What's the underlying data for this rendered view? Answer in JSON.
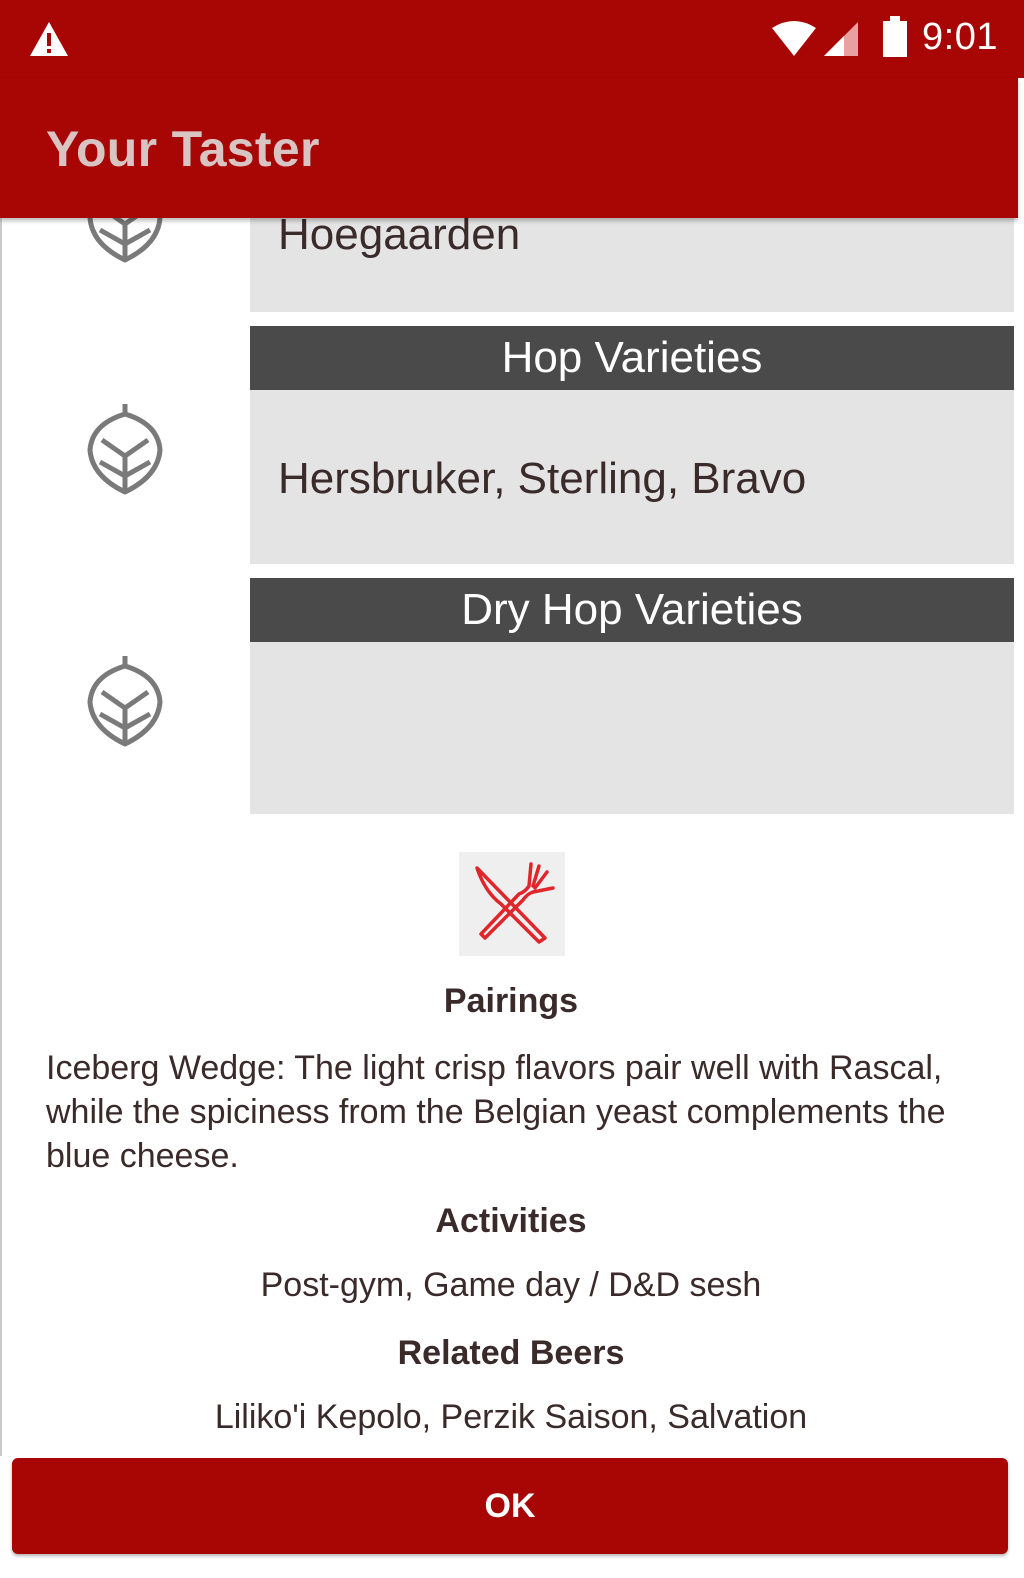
{
  "status_bar": {
    "time": "9:01",
    "icons": [
      "warning-icon",
      "wifi-icon",
      "signal-icon",
      "battery-icon"
    ]
  },
  "app_bar": {
    "title": "Your Taster"
  },
  "content": {
    "partial_card": {
      "value": "Hoegaarden"
    },
    "hop_card": {
      "header": "Hop Varieties",
      "value": "Hersbruker, Sterling, Bravo",
      "icon": "hop-icon"
    },
    "dry_hop_card": {
      "header": "Dry Hop Varieties",
      "value": "",
      "icon": "hop-icon"
    },
    "pairings": {
      "icon": "cutlery-icon",
      "title": "Pairings",
      "text": "Iceberg Wedge: The light crisp flavors pair well with Rascal, while the spiciness from the Belgian yeast complements the blue cheese."
    },
    "activities": {
      "title": "Activities",
      "text": "Post-gym, Game day / D&D sesh"
    },
    "related": {
      "title": "Related Beers",
      "text": "Liliko'i Kepolo, Perzik Saison, Salvation"
    }
  },
  "ok_button": {
    "label": "OK"
  },
  "colors": {
    "brand_red": "#a80505",
    "card_bg": "#e4e4e4",
    "header_bg": "#4a4a4a"
  }
}
